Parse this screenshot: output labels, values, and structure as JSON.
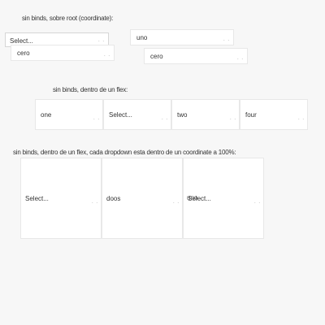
{
  "section1": {
    "heading": "sin binds, sobre root (coordinate):",
    "dropdowns": [
      {
        "value": "Select..."
      },
      {
        "value": "uno"
      },
      {
        "value": "cero"
      },
      {
        "value": "cero"
      }
    ]
  },
  "section2": {
    "heading": "sin binds, dentro de un flex:",
    "dropdowns": [
      {
        "value": "one"
      },
      {
        "value": "Select..."
      },
      {
        "value": "two"
      },
      {
        "value": "four"
      }
    ]
  },
  "section3": {
    "heading": "sin binds, dentro de un flex, cada dropdown esta dentro de un coordinate a 100%:",
    "dropdowns": [
      {
        "value": "Select..."
      },
      {
        "value": "doos"
      },
      {
        "value": "Select...",
        "overlap_value": "uno"
      }
    ]
  },
  "caret_glyph": ". ."
}
